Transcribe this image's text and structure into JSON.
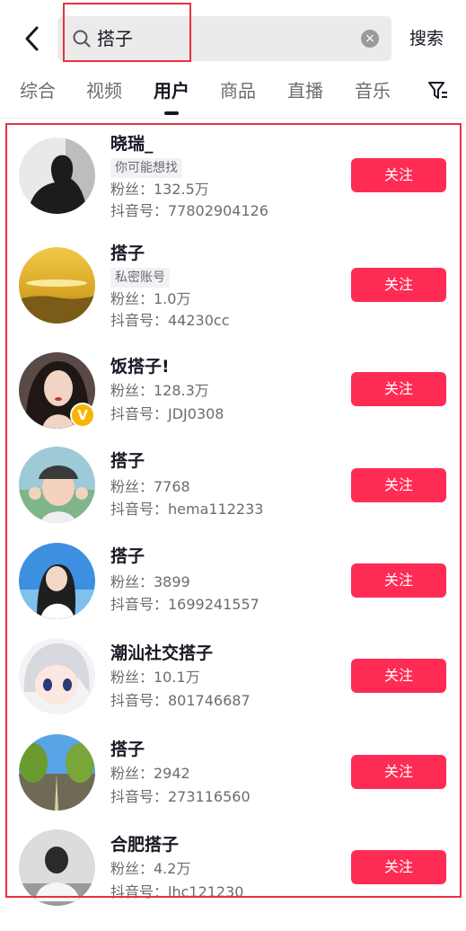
{
  "search": {
    "query": "搭子",
    "submit_label": "搜索"
  },
  "tabs": [
    {
      "label": "综合"
    },
    {
      "label": "视频"
    },
    {
      "label": "用户"
    },
    {
      "label": "商品"
    },
    {
      "label": "直播"
    },
    {
      "label": "音乐"
    }
  ],
  "active_tab": "用户",
  "colors": {
    "accent": "#fe2c55",
    "highlight_frame": "#e8323c"
  },
  "users": [
    {
      "name": "晓瑞_",
      "tag": "你可能想找",
      "fans": "粉丝：132.5万",
      "id": "抖音号：77802904126",
      "follow_label": "关注"
    },
    {
      "name": "搭子",
      "tag": "私密账号",
      "fans": "粉丝：1.0万",
      "id": "抖音号：44230cc",
      "follow_label": "关注"
    },
    {
      "name": "饭搭子!",
      "fans": "粉丝：128.3万",
      "id": "抖音号：JDJ0308",
      "follow_label": "关注",
      "verified": true
    },
    {
      "name": "搭子",
      "fans": "粉丝：7768",
      "id": "抖音号：hema112233",
      "follow_label": "关注"
    },
    {
      "name": "搭子",
      "fans": "粉丝：3899",
      "id": "抖音号：1699241557",
      "follow_label": "关注"
    },
    {
      "name": "潮汕社交搭子",
      "fans": "粉丝：10.1万",
      "id": "抖音号：801746687",
      "follow_label": "关注"
    },
    {
      "name": "搭子",
      "fans": "粉丝：2942",
      "id": "抖音号：273116560",
      "follow_label": "关注"
    },
    {
      "name": "合肥搭子",
      "fans": "粉丝：4.2万",
      "id": "抖音号：lhc121230",
      "follow_label": "关注"
    }
  ]
}
